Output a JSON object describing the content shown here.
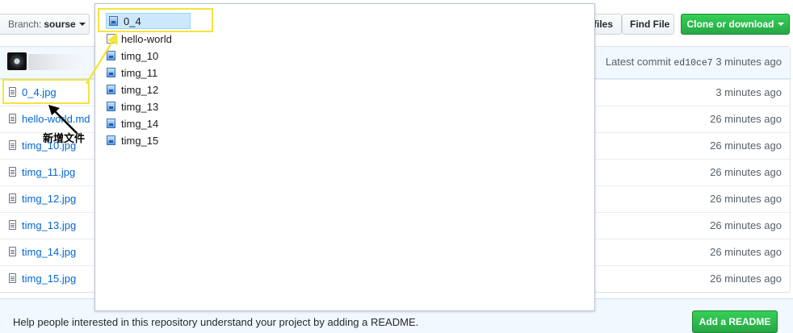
{
  "toolbar": {
    "branch_label": "Branch:",
    "branch_value": "sourse",
    "files_label": "files",
    "find_file_label": "Find File",
    "clone_label": "Clone or download"
  },
  "commit": {
    "prefix": "Latest commit",
    "hash": "ed10ce7",
    "age": "3 minutes ago"
  },
  "files": [
    {
      "name": "0_4.jpg",
      "age": "3 minutes ago"
    },
    {
      "name": "hello-world.md",
      "age": "26 minutes ago"
    },
    {
      "name": "timg_10.jpg",
      "age": "26 minutes ago"
    },
    {
      "name": "timg_11.jpg",
      "age": "26 minutes ago"
    },
    {
      "name": "timg_12.jpg",
      "age": "26 minutes ago"
    },
    {
      "name": "timg_13.jpg",
      "age": "26 minutes ago"
    },
    {
      "name": "timg_14.jpg",
      "age": "26 minutes ago"
    },
    {
      "name": "timg_15.jpg",
      "age": "26 minutes ago"
    }
  ],
  "readme": {
    "text": "Help people interested in this repository understand your project by adding a README.",
    "button": "Add a README"
  },
  "picker": {
    "items": [
      {
        "name": "0_4",
        "icon": "image-file-icon",
        "selected": true
      },
      {
        "name": "hello-world",
        "icon": "document-file-icon"
      },
      {
        "name": "timg_10",
        "icon": "image-file-icon"
      },
      {
        "name": "timg_11",
        "icon": "image-file-icon"
      },
      {
        "name": "timg_12",
        "icon": "image-file-icon"
      },
      {
        "name": "timg_13",
        "icon": "image-file-icon"
      },
      {
        "name": "timg_14",
        "icon": "image-file-icon"
      },
      {
        "name": "timg_15",
        "icon": "image-file-icon"
      }
    ]
  },
  "annotation": {
    "note": "新增文件",
    "highlight_color": "#f5e43c"
  },
  "colors": {
    "link": "#0366d6",
    "primary_green": "#28a745",
    "commit_bar": "#f1f8ff"
  }
}
